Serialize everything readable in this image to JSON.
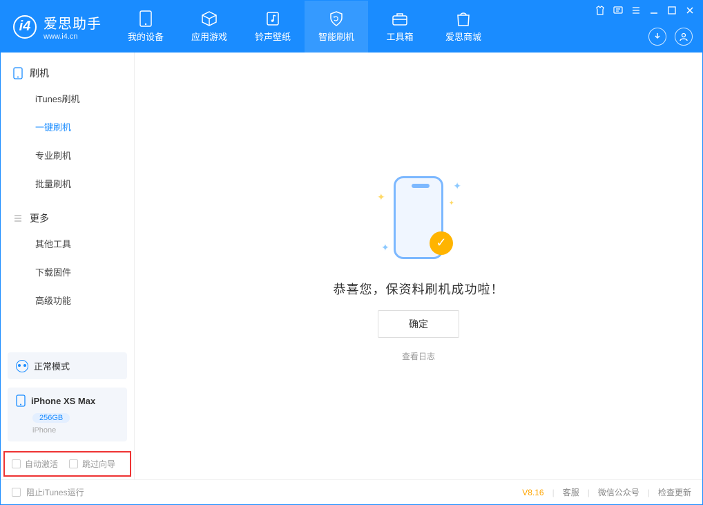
{
  "app": {
    "name_cn": "爱思助手",
    "name_en": "www.i4.cn"
  },
  "nav": {
    "tabs": [
      {
        "label": "我的设备"
      },
      {
        "label": "应用游戏"
      },
      {
        "label": "铃声壁纸"
      },
      {
        "label": "智能刷机"
      },
      {
        "label": "工具箱"
      },
      {
        "label": "爱思商城"
      }
    ]
  },
  "sidebar": {
    "section1": {
      "title": "刷机",
      "items": [
        "iTunes刷机",
        "一键刷机",
        "专业刷机",
        "批量刷机"
      ]
    },
    "section2": {
      "title": "更多",
      "items": [
        "其他工具",
        "下载固件",
        "高级功能"
      ]
    },
    "mode": "正常模式",
    "device": {
      "name": "iPhone XS Max",
      "capacity": "256GB",
      "type": "iPhone"
    },
    "options": {
      "auto_activate": "自动激活",
      "skip_guide": "跳过向导"
    }
  },
  "main": {
    "success_text": "恭喜您，保资料刷机成功啦！",
    "ok_label": "确定",
    "log_link": "查看日志"
  },
  "footer": {
    "block_itunes": "阻止iTunes运行",
    "version": "V8.16",
    "links": [
      "客服",
      "微信公众号",
      "检查更新"
    ]
  }
}
